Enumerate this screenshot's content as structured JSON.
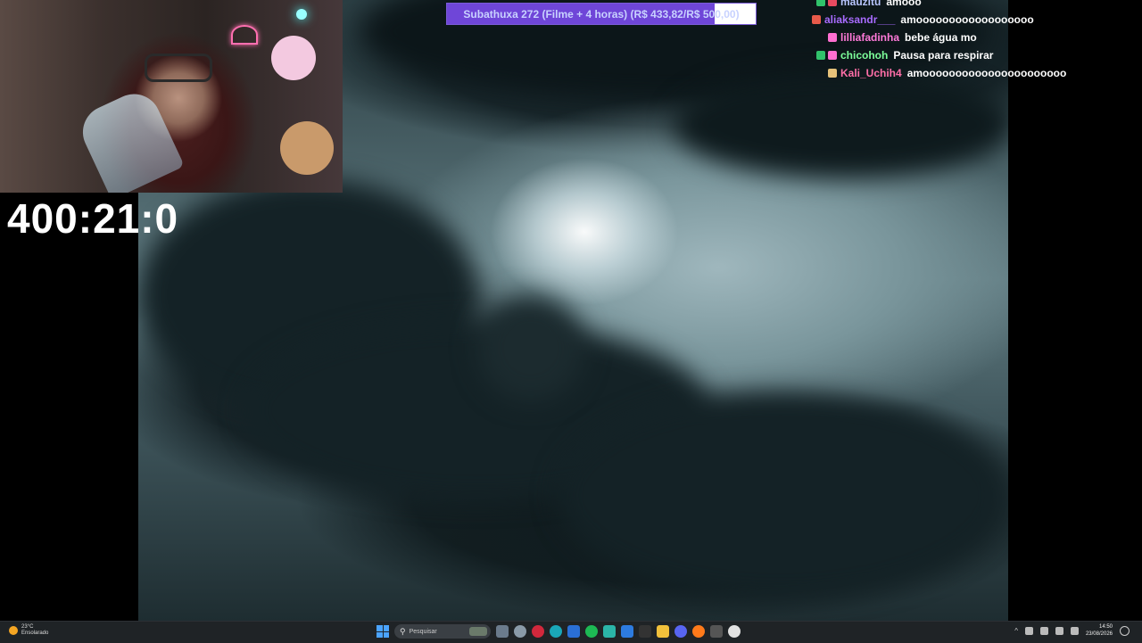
{
  "goal": {
    "text": "Subathuxa 272 (Filme + 4 horas) (R$ 433,82/R$ 500,00)",
    "progress": 0.8676
  },
  "timer": "400:21:0",
  "chat": [
    {
      "user": "mauzitu",
      "text": "amooo",
      "color": "#b9c6ff"
    },
    {
      "user": "aliaksandr___",
      "text": "amoooooooooooooooooo",
      "color": "#a86bff"
    },
    {
      "user": "lilliafadinha",
      "text": "bebe água mo",
      "color": "#ff7ad9"
    },
    {
      "user": "chicohoh",
      "text": "Pausa para respirar",
      "color": "#7dff9a"
    },
    {
      "user": "Kali_Uchih4",
      "text": "amoooooooooooooooooooooo",
      "color": "#ff6fa8"
    }
  ],
  "taskbar": {
    "weather_temp": "23°C",
    "weather_desc": "Ensolarado",
    "search_placeholder": "Pesquisar",
    "time": "14:50",
    "date": "23/08/2026"
  },
  "colors": {
    "goal_fill": "#6f46d8",
    "taskbar": "#1f2326"
  }
}
